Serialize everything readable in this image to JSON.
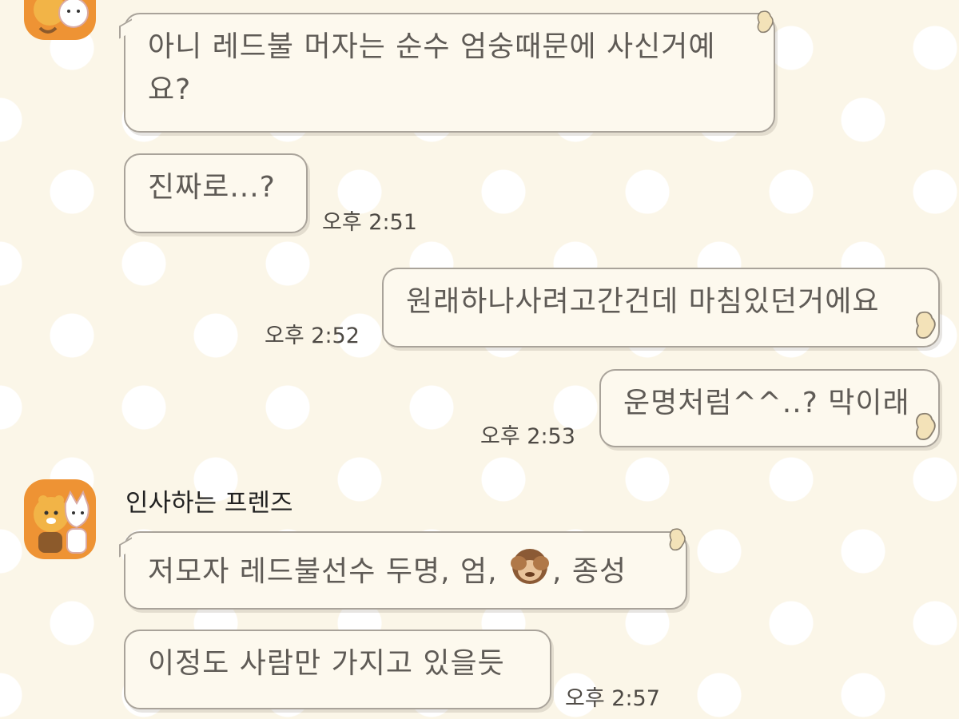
{
  "chat": {
    "sender_name": "인사하는 프렌즈",
    "messages": [
      {
        "text": "아니 레드불 머자는 순수 엄숭때문에 사신거예요?"
      },
      {
        "text": "진짜로...?",
        "time": "오후 2:51"
      },
      {
        "text": "원래하나사려고간건데 마침있던거에요",
        "time": "오후 2:52"
      },
      {
        "text": "운명처럼^^..? 막이래",
        "time": "오후 2:53"
      },
      {
        "text_before": "저모자 레드불선수 두명, 엄, ",
        "emoji": "see-no-evil-monkey-icon",
        "text_after": ", 종성"
      },
      {
        "text": "이정도 사람만 가지고 있을듯",
        "time": "오후 2:57"
      }
    ]
  },
  "colors": {
    "background": "#fbf6e8",
    "bubble": "#fdf9ee",
    "bubble_border": "#a9a39a",
    "avatar_bg": "#ee9334"
  },
  "icons": {
    "avatar": "friends-avatar-icon",
    "bubble_decoration": "peanut-charm-icon"
  }
}
